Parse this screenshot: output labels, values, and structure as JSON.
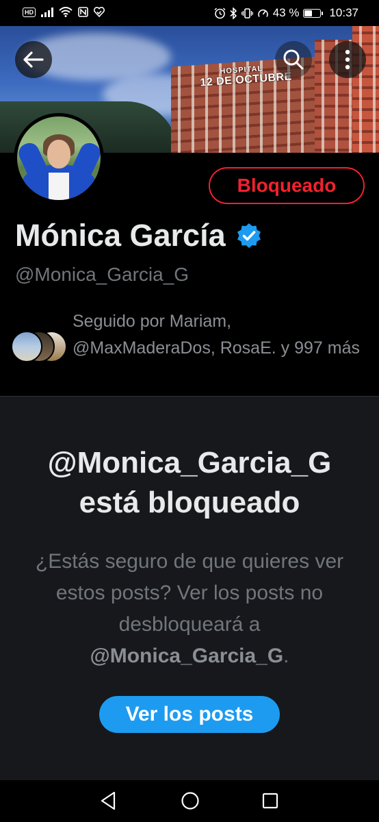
{
  "status_bar": {
    "hd_badge": "HD",
    "battery_percent": "43 %",
    "battery_level": 0.43,
    "time": "10:37"
  },
  "header": {
    "banner_sign_line1": "HOSPITAL",
    "banner_sign_line2": "12 DE OCTUBRE",
    "back_icon": "arrow-left-icon",
    "search_icon": "search-icon",
    "more_icon": "more-vertical-icon"
  },
  "profile": {
    "name": "Mónica García",
    "handle": "@Monica_Garcia_G",
    "verified": true,
    "blocked_label": "Bloqueado",
    "followed_by": "Seguido por Mariam, @MaxMaderaDos, RosaE. y 997 más"
  },
  "blocked_notice": {
    "title_handle": "@Monica_Garcia_G",
    "title_suffix": "está bloqueado",
    "desc_text": "¿Estás seguro de que quieres ver estos posts? Ver los posts no desbloqueará a",
    "desc_handle": "@Monica_Garcia_G",
    "desc_end": ".",
    "button_label": "Ver los posts"
  },
  "colors": {
    "accent": "#1d9bf0",
    "blocked": "#f4212e",
    "verified": "#1d9bf0"
  }
}
